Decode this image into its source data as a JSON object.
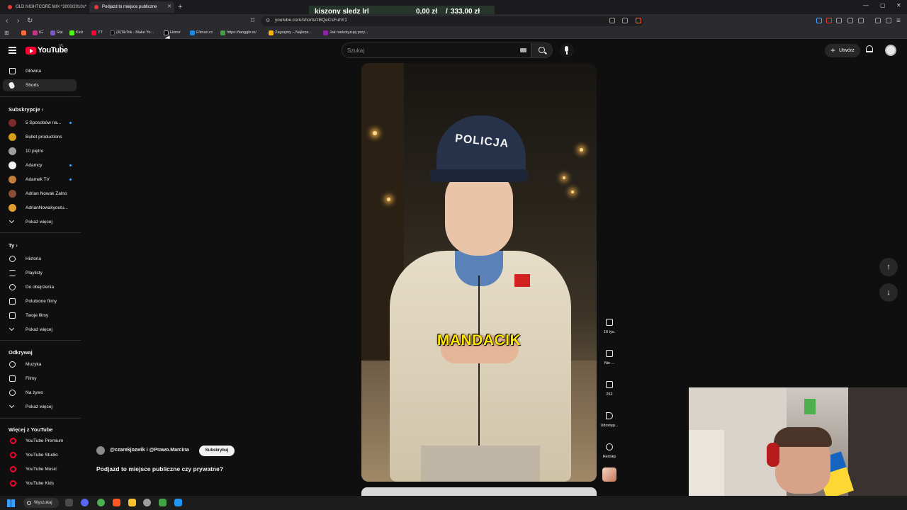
{
  "browser": {
    "tabs": [
      {
        "title": "OLD NIGHTCORE MIX *2000/2010s*",
        "active": false
      },
      {
        "title": "Podjazd to miejsce publiczne",
        "active": true
      }
    ],
    "new_tab": "+",
    "url": "youtube.com/shorts/zBQeCsFuhY1",
    "bookmarks": [
      "IG",
      "Rat",
      "Kick",
      "YT",
      "(4)TikTok - Make Yo...",
      "Home",
      "Filman.cc",
      "https://tanggle.io/",
      "Zagrajmy – Najleps...",
      "Jak narkotyzują przy..."
    ]
  },
  "overlay": {
    "label": "kiszony sledz lrl",
    "amount": "0,00 zł",
    "goal": "333,00 zł"
  },
  "header": {
    "logo": "YouTube",
    "country": "PL",
    "search_placeholder": "Szukaj",
    "create_label": "Utwórz"
  },
  "sidebar": {
    "main": [
      {
        "label": "Główna",
        "icon": "home-icon",
        "active": false
      },
      {
        "label": "Shorts",
        "icon": "shorts-icon",
        "active": true
      }
    ],
    "subs_title": "Subskrypcje",
    "subscriptions": [
      {
        "label": "5 Sposobów na...",
        "color": "#7a2b2b",
        "dot": true
      },
      {
        "label": "Bullet productions",
        "color": "#d4a017",
        "dot": false
      },
      {
        "label": "10 piętro",
        "color": "#9e9e9e",
        "dot": false
      },
      {
        "label": "Adamcy",
        "color": "#f1f1f1",
        "dot": true
      },
      {
        "label": "Adamek TV",
        "color": "#c0803a",
        "dot": true
      },
      {
        "label": "Adrian Nowak Żalno",
        "color": "#8b4c3a",
        "dot": false
      },
      {
        "label": "AdrianNowakyoutu...",
        "color": "#e0a030",
        "dot": false
      }
    ],
    "subs_more": "Pokaż więcej",
    "you_title": "Ty",
    "you": [
      {
        "label": "Historia",
        "icon": "history-icon"
      },
      {
        "label": "Playlisty",
        "icon": "playlist-icon"
      },
      {
        "label": "Do obejrzenia",
        "icon": "watch-later-icon"
      },
      {
        "label": "Polubione filmy",
        "icon": "like-icon"
      },
      {
        "label": "Twoje filmy",
        "icon": "your-videos-icon"
      }
    ],
    "you_more": "Pokaż więcej",
    "explore_title": "Odkrywaj",
    "explore": [
      {
        "label": "Muzyka",
        "icon": "music-icon"
      },
      {
        "label": "Filmy",
        "icon": "movies-icon"
      },
      {
        "label": "Na żywo",
        "icon": "live-icon"
      }
    ],
    "explore_more": "Pokaż więcej",
    "more_title": "Więcej z YouTube",
    "more": [
      {
        "label": "YouTube Premium"
      },
      {
        "label": "YouTube Studio"
      },
      {
        "label": "YouTube Music"
      },
      {
        "label": "YouTube Kids"
      }
    ]
  },
  "short": {
    "caption": "MANDACIK",
    "cap_text": "POLICJA",
    "channel": "@czarekjozwik i @Prawo.Marcina",
    "subscribe": "Subskrybuj",
    "title": "Podjazd to miejsce publiczne czy prywatne?"
  },
  "actions": {
    "likes": "16 tys.",
    "dislike": "Nie ...",
    "comments": "262",
    "share": "Udostęp...",
    "remix": "Remiks"
  },
  "taskbar": {
    "search": "Wyszukaj"
  }
}
